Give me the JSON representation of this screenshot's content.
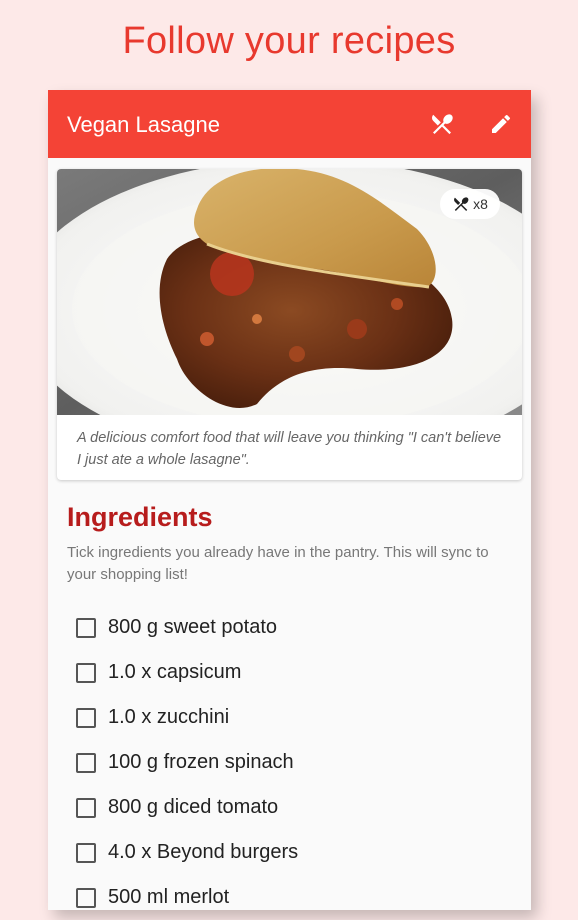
{
  "promo": {
    "title": "Follow your recipes"
  },
  "appbar": {
    "title": "Vegan Lasagne",
    "cook_icon": "utensils-icon",
    "edit_icon": "pencil-icon"
  },
  "recipe": {
    "servings_label": "x8",
    "description": "A delicious comfort food that will leave you thinking \"I can't believe I just ate a whole lasagne\"."
  },
  "ingredients": {
    "title": "Ingredients",
    "hint": "Tick ingredients you already have in the pantry. This will sync to your shopping list!",
    "items": [
      {
        "label": "800 g sweet potato",
        "checked": false
      },
      {
        "label": "1.0 x capsicum",
        "checked": false
      },
      {
        "label": "1.0 x zucchini",
        "checked": false
      },
      {
        "label": "100 g frozen spinach",
        "checked": false
      },
      {
        "label": "800 g diced tomato",
        "checked": false
      },
      {
        "label": "4.0 x Beyond burgers",
        "checked": false
      },
      {
        "label": "500 ml merlot",
        "checked": false
      }
    ]
  },
  "colors": {
    "accent": "#f44336",
    "heading": "#b71c1c",
    "background": "#fde9e8"
  }
}
